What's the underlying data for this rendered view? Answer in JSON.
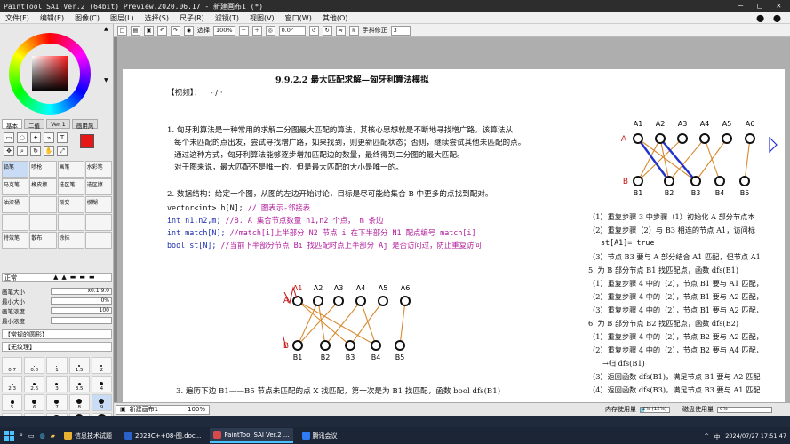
{
  "window": {
    "title": "PaintTool SAI Ver.2 (64bit) Preview.2020.06.17 - 新建画布1 (*)",
    "minimize": "—",
    "maximize": "□",
    "close": "✕"
  },
  "menu": [
    "文件(F)",
    "编辑(E)",
    "图像(C)",
    "图层(L)",
    "选择(S)",
    "尺子(R)",
    "滤镜(T)",
    "视图(V)",
    "窗口(W)",
    "其他(O)"
  ],
  "menu_right": [
    "⬤",
    "⬤"
  ],
  "left_tabs": [
    "基本",
    "二值",
    "Ver 1",
    "画用风"
  ],
  "brushes": [
    "铅笔",
    "喷枪",
    "画笔",
    "水彩笔",
    "马克笔",
    "橡皮擦",
    "选区笔",
    "选区擦",
    "油漆桶",
    "",
    "渐变",
    "模糊",
    "",
    "",
    "",
    "",
    "特效笔",
    "散布",
    "涂抹",
    ""
  ],
  "mode": {
    "label": "正常"
  },
  "props": [
    {
      "label": "画笔大小",
      "value": "x0.1    9.0"
    },
    {
      "label": "最小大小",
      "value": "0%"
    },
    {
      "label": "画笔浓度",
      "value": "100"
    },
    {
      "label": "最小浓度",
      "value": ""
    }
  ],
  "checks": [
    "【常规的圆形】",
    "【无纹理】"
  ],
  "dot_sizes": [
    "0.7",
    "0.8",
    "1",
    "1.5",
    "2",
    "2.3",
    "2.6",
    "3",
    "3.5",
    "4",
    "5",
    "6",
    "7",
    "8",
    "9",
    "10",
    "12",
    "14",
    "16",
    "20"
  ],
  "toolbar": {
    "select_label": "选择",
    "zoom": "100%",
    "angle": "0.0°",
    "stabilizer_label": "手抖修正",
    "stabilizer_value": "3"
  },
  "doc": {
    "heading": "9.9.2.2 最大匹配求解—匈牙利算法模拟",
    "video_label": "【视频】：",
    "video_value": "- / ·",
    "p1": [
      "1.  匈牙利算法是一种常用的求解二分图最大匹配的算法，其核心思想就是不断地寻找增广路。该算法从",
      "每个未匹配的点出发，尝试寻找增广路，如果找到，则更新匹配状态；否则，继续尝试其他未匹配的点。",
      "通过这种方式，匈牙利算法能够逐步增加匹配边的数量，最终得到二分图的最大匹配。",
      "对于图来说，最大匹配不是唯一的，但是最大匹配的大小是唯一的。"
    ],
    "p2": "2. 数据结构：给定一个图，从图的左边开始讨论，目标是尽可能给集合 B 中更多的点找到配对。",
    "code": [
      {
        "a": "vector<int> h[N];",
        "c": "// 图表示-邻接表"
      },
      {
        "a": "int n1,n2,m;",
        "c": "//B. A 集合节点数量 n1,n2 个点， m 条边"
      },
      {
        "a": "int match[N];",
        "c": "//match[i]上半部分 N2 节点 i 在下半部分 N1 配点编号 match[i]"
      },
      {
        "a": "bool st[N];",
        "c": "//当前下半部分节点 Bi 找匹配时点上半部分 Aj 是否访问过，防止重复访问"
      }
    ],
    "p3": "3.  遍历下边 B1——B5 节点未匹配的点 X 找匹配，第一次是为 B1 找匹配，函数 bool dfs(B1)",
    "right_notes": [
      "（1）重复步骤 3 中步骤（1）初始化 A 部分节点本",
      "（2）重复步骤（2）与 B3 相连的节点 A1，访问标",
      "st[A1]= true",
      "（3）节点 B3 要与 A 部分结合 A1 匹配，但节点 A1",
      "5.  为 B 部分节点 B1 找匹配点，函数 dfs(B1)",
      "（1）重复步骤 4 中的（2），节点 B1 要与 A1 匹配，",
      "（2）重复步骤 4 中的（2），节点 B1 要与 A2 匹配，",
      "（3）重复步骤 4 中的（2），节点 B1 要与 A2 匹配，",
      "6.  为 B 部分节点 B2 找匹配点，函数 dfs(B2)",
      "（1）重复步骤 4 中的（2），节点 B2 要与 A2 匹配，",
      "（2）重复步骤 4 中的（2），节点 B2 要与 A4 匹配，",
      "→归 dfs(B1)",
      "（3）返回函数 dfs(B1)，满足节点 B1 要与 A2 匹配",
      "（4）返回函数 dfs(B3)，满足节点 B3 要与 A1 匹配"
    ],
    "graph_top": [
      "A1",
      "A2",
      "A3",
      "A4",
      "A5",
      "A6"
    ],
    "graph_bottom": [
      "B1",
      "B2",
      "B3",
      "B4",
      "B5"
    ],
    "label_a": "A",
    "label_b": "B"
  },
  "status": {
    "doc_tab": "新建画布1",
    "doc_zoom": "100%",
    "mem_label": "内存使用量",
    "mem_value": "2% (12%)",
    "mem_fill": 0.12,
    "disk_label": "磁盘使用量",
    "disk_value": "0%",
    "disk_fill": 0.0
  },
  "taskbar": {
    "apps": [
      {
        "label": "信息技术试题",
        "color": "#e8b230"
      },
      {
        "label": "2023C++08-图.doc...",
        "color": "#2b62c8"
      },
      {
        "label": "PaintTool SAI Ver.2 ...",
        "color": "#d84a4a"
      },
      {
        "label": "腾讯会议",
        "color": "#2f7bf2"
      }
    ],
    "tray": [
      "^",
      "中",
      "2024/07/27 17:51:47"
    ]
  },
  "colors": {
    "accent": "#e61717",
    "code_keyword": "#1b2fb0",
    "code_comment": "#b01b9b",
    "graph_line": "#d7892e",
    "match_line": "#2233cc"
  }
}
